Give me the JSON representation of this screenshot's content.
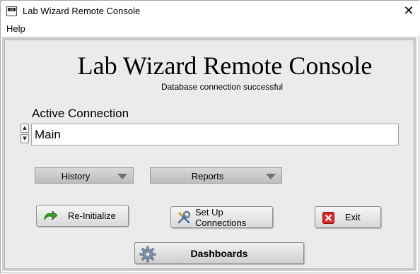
{
  "window": {
    "title": "Lab Wizard Remote Console",
    "icon_text": "LW",
    "close_glyph": "✕"
  },
  "menu": {
    "items": [
      "Help"
    ]
  },
  "main": {
    "heading": "Lab Wizard Remote Console",
    "status": "Database connection successful",
    "connection_label": "Active Connection",
    "connection_value": "Main",
    "spin_up_glyph": "▲",
    "spin_down_glyph": "▼"
  },
  "dropdowns": {
    "history": "History",
    "reports": "Reports"
  },
  "buttons": {
    "reinitialize": "Re-Initialize",
    "setup": "Set Up Connections",
    "exit": "Exit",
    "dashboards": "Dashboards"
  },
  "icons": {
    "reinitialize": "refresh-arrow-icon",
    "setup": "wrench-screwdriver-icon",
    "exit": "red-x-icon",
    "dashboards": "gear-icon"
  },
  "colors": {
    "panel_bg": "#ebebeb",
    "refresh_green": "#3e9b2a",
    "exit_red": "#d42a2a"
  }
}
